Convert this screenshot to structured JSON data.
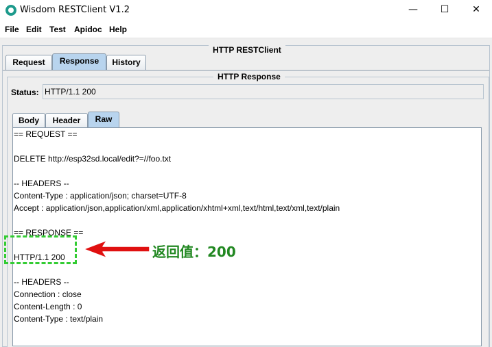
{
  "window": {
    "title": "Wisdom RESTClient V1.2",
    "minimize_glyph": "—",
    "maximize_glyph": "☐",
    "close_glyph": "✕"
  },
  "menu": [
    "File",
    "Edit",
    "Test",
    "Apidoc",
    "Help"
  ],
  "main_panel": {
    "title": "HTTP RESTClient"
  },
  "main_tabs": [
    "Request",
    "Response",
    "History"
  ],
  "response_panel": {
    "title": "HTTP Response",
    "status_label": "Status:",
    "status_value": "HTTP/1.1 200"
  },
  "response_tabs": [
    "Body",
    "Header",
    "Raw"
  ],
  "raw_lines": [
    "== REQUEST ==",
    "",
    "DELETE http://esp32sd.local/edit?=//foo.txt",
    "",
    "-- HEADERS --",
    "Content-Type : application/json; charset=UTF-8",
    "Accept : application/json,application/xml,application/xhtml+xml,text/html,text/xml,text/plain",
    "",
    "== RESPONSE ==",
    "",
    "HTTP/1.1 200",
    "",
    "-- HEADERS --",
    "Connection : close",
    "Content-Length : 0",
    "Content-Type : text/plain"
  ],
  "annotation": {
    "text": "返回值：200",
    "color": "#228822",
    "arrow_color": "#e01010"
  },
  "colors": {
    "active_tab": "#b8d4ee",
    "highlight": "#33cc33",
    "app_icon": "#1d9a8c"
  }
}
